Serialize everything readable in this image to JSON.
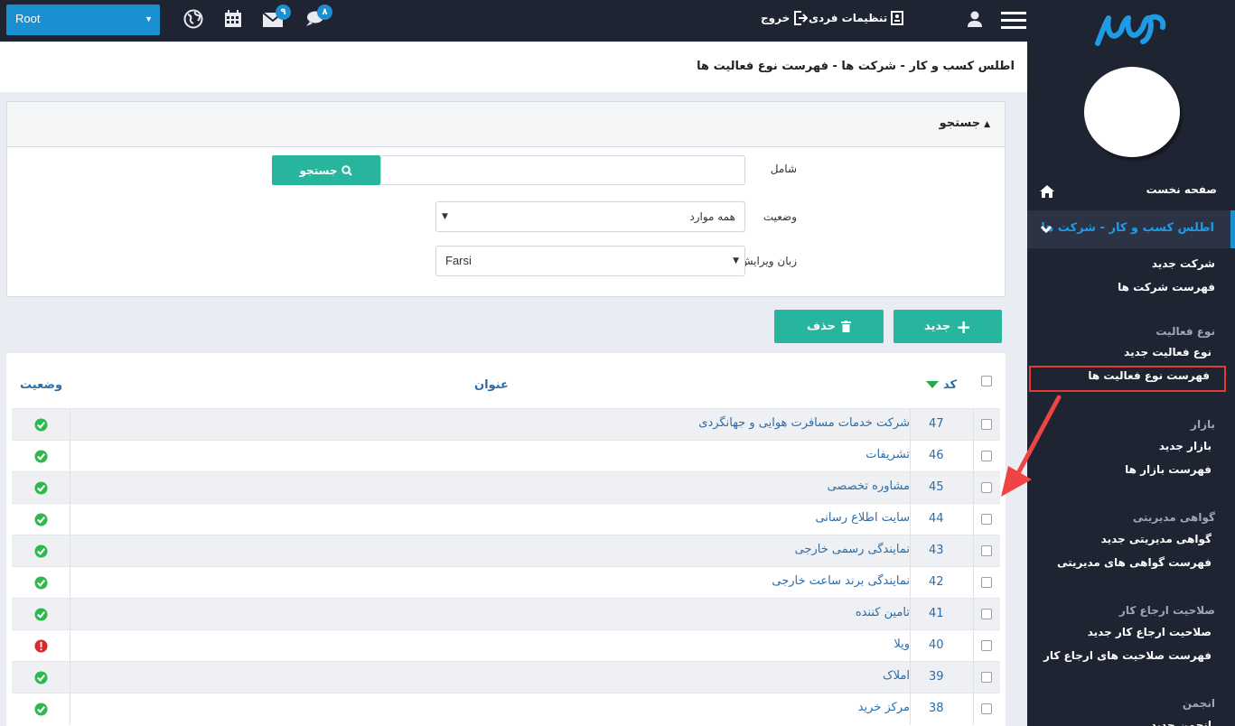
{
  "topbar": {
    "root_select": "Root",
    "mail_badge": "۹",
    "chat_badge": "۸",
    "settings_label": "تنظیمات فردی",
    "logout_label": "خروج"
  },
  "breadcrumb": "اطلس کسب و کار - شرکت ها - فهرست نوع فعالیت ها",
  "search": {
    "title": "جستجو",
    "contains_label": "شامل",
    "contains_value": "",
    "search_button": "جستجو",
    "status_label": "وضعیت",
    "status_value": "همه موارد",
    "lang_label": "زبان ویرایش",
    "lang_value": "Farsi"
  },
  "actions": {
    "new": "جدید",
    "delete": "حذف"
  },
  "table": {
    "col_code": "کد",
    "col_title": "عنوان",
    "col_status": "وضعیت",
    "rows": [
      {
        "code": "47",
        "title": "شرکت خدمات مسافرت هوایی و جهانگردی",
        "status": "active"
      },
      {
        "code": "46",
        "title": "تشریفات",
        "status": "active"
      },
      {
        "code": "45",
        "title": "مشاوره تخصصی",
        "status": "active"
      },
      {
        "code": "44",
        "title": "سایت اطلاع رسانی",
        "status": "active"
      },
      {
        "code": "43",
        "title": "نمایندگی رسمی خارجی",
        "status": "active"
      },
      {
        "code": "42",
        "title": "نمایندگی برند ساعت خارجی",
        "status": "active"
      },
      {
        "code": "41",
        "title": "تامین کننده",
        "status": "active"
      },
      {
        "code": "40",
        "title": "ویلا",
        "status": "inactive"
      },
      {
        "code": "39",
        "title": "املاک",
        "status": "active"
      },
      {
        "code": "38",
        "title": "مرکز خرید",
        "status": "active"
      }
    ]
  },
  "sidebar": {
    "home": "صفحه نخست",
    "active_group": "اطلس کسب و کار - شرکت ها",
    "new_company": "شرکت جدید",
    "company_list": "فهرست شرکت ها",
    "activity_head": "نوع فعالیت",
    "activity_new": "نوع فعالیت جدید",
    "activity_list": "فهرست نوع فعالیت ها",
    "market_head": "بازار",
    "market_new": "بازار جدید",
    "market_list": "فهرست بازار ها",
    "cert_head": "گواهی مدیریتی",
    "cert_new": "گواهی مدیریتی جدید",
    "cert_list": "فهرست گواهی های مدیریتی",
    "ref_head": "صلاحیت ارجاع کار",
    "ref_new": "صلاحیت ارجاع کار جدید",
    "ref_list": "فهرست صلاحیت های ارجاع کار",
    "assoc_head": "انجمن",
    "assoc_new": "انجمن جدید"
  },
  "colors": {
    "accent": "#1a8fd1",
    "button": "#27b59d",
    "sidebar": "#1e2432",
    "highlight": "#e53935"
  }
}
